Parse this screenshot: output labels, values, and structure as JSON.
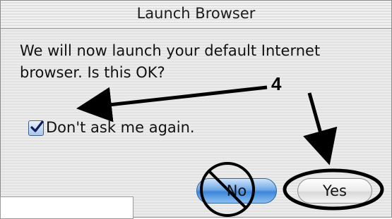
{
  "window": {
    "title": "Launch Browser"
  },
  "message": {
    "line1": "We will now launch your default Internet",
    "line2": "browser. Is this OK?"
  },
  "checkbox": {
    "label": "Don't ask me again.",
    "checked": true
  },
  "buttons": {
    "no_label": "No",
    "yes_label": "Yes"
  },
  "annotation": {
    "step_number": "4"
  },
  "colors": {
    "default_button": "#3d86d9",
    "annotation": "#000000"
  }
}
